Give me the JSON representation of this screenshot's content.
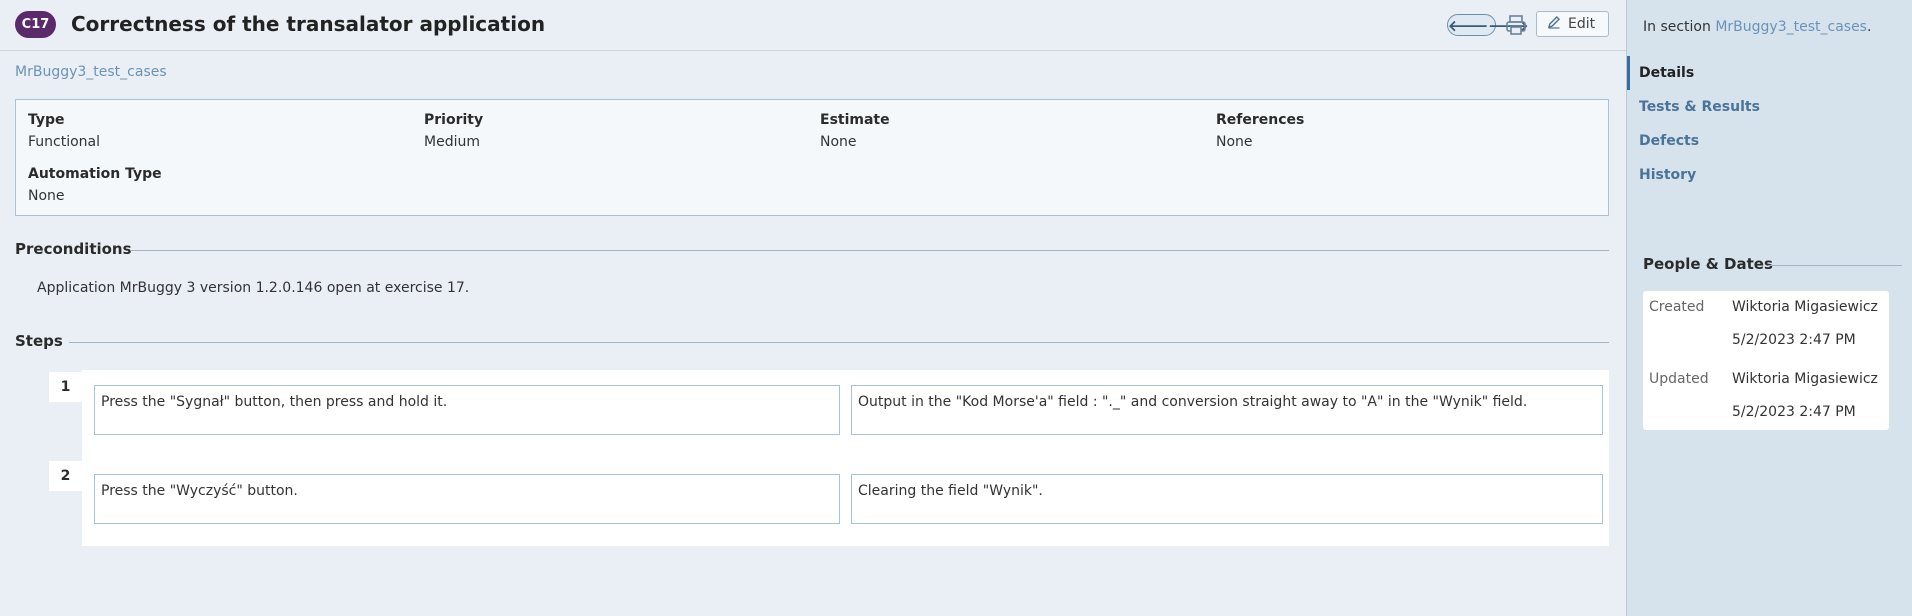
{
  "case": {
    "id_badge": "C17",
    "title": "Correctness of the transalator application",
    "section_link": "MrBuggy3_test_cases"
  },
  "toolbar": {
    "prev_icon": "arrow-left-icon",
    "next_icon": "arrow-right-icon",
    "prev_glyph": "🡐",
    "next_glyph": "🡒",
    "print_icon": "printer-icon",
    "edit_label": "Edit"
  },
  "fields": {
    "type_label": "Type",
    "type_value": "Functional",
    "priority_label": "Priority",
    "priority_value": "Medium",
    "estimate_label": "Estimate",
    "estimate_value": "None",
    "references_label": "References",
    "references_value": "None",
    "automation_label": "Automation Type",
    "automation_value": "None"
  },
  "preconditions": {
    "heading": "Preconditions",
    "text": "Application MrBuggy 3 version 1.2.0.146 open at exercise 17."
  },
  "steps": {
    "heading": "Steps",
    "items": [
      {
        "number": "1",
        "action": "Press the \"Sygnał\" button, then press and hold it.",
        "expected": "Output in the \"Kod Morse'a\" field : \"._\" and conversion straight away to \"A\" in the \"Wynik\" field."
      },
      {
        "number": "2",
        "action": "Press the \"Wyczyść\" button.",
        "expected": "Clearing the field \"Wynik\"."
      }
    ]
  },
  "sidebar": {
    "in_section_prefix": "In section ",
    "in_section_link": "MrBuggy3_test_cases",
    "in_section_suffix": ".",
    "nav": [
      {
        "label": "Details",
        "active": true
      },
      {
        "label": "Tests & Results",
        "active": false
      },
      {
        "label": "Defects",
        "active": false
      },
      {
        "label": "History",
        "active": false
      }
    ],
    "people_dates": {
      "heading": "People & Dates",
      "created_label": "Created",
      "created_by": "Wiktoria Migasiewicz",
      "created_at": "5/2/2023 2:47 PM",
      "updated_label": "Updated",
      "updated_by": "Wiktoria Migasiewicz",
      "updated_at": "5/2/2023 2:47 PM"
    }
  },
  "colors": {
    "badge": "#5b2a6b",
    "link": "#6b93b8",
    "sidebar_bg": "#d6e3ed",
    "main_bg": "#e9eff5"
  }
}
